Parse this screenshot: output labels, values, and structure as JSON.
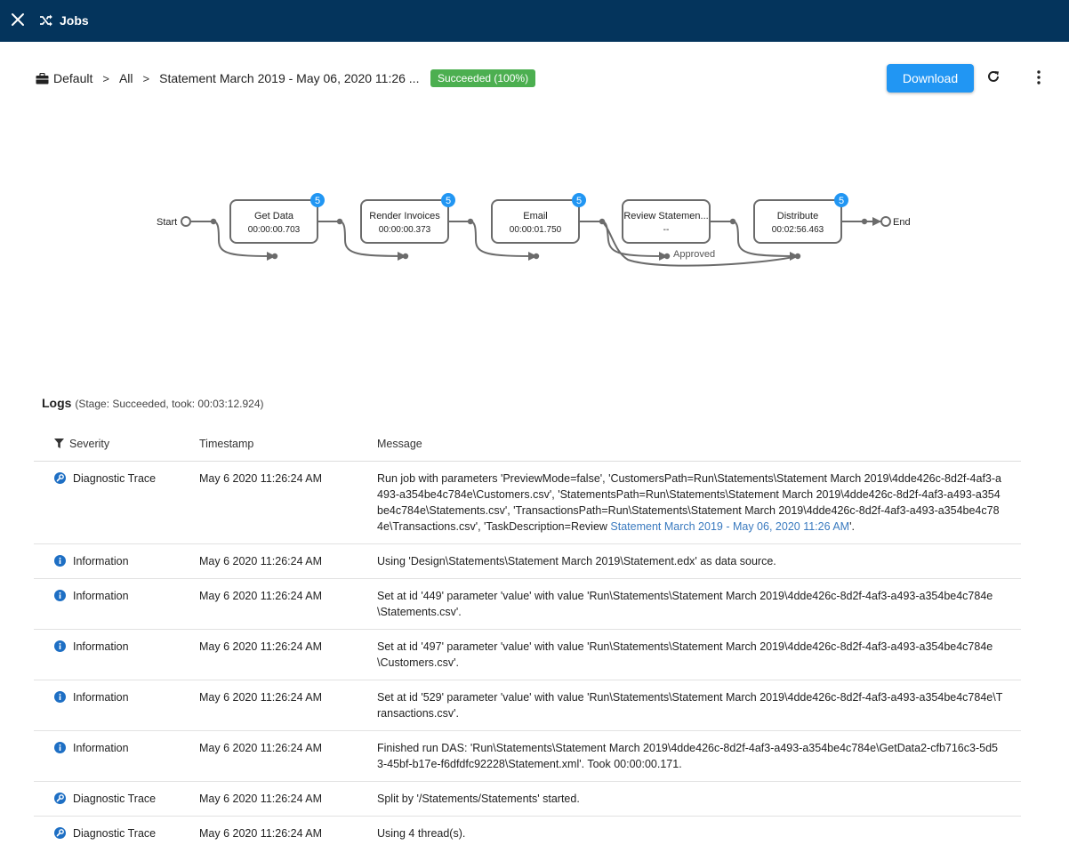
{
  "topbar": {
    "title": "Jobs",
    "close_icon": "close-icon",
    "app_icon": "shuffle-icon",
    "bg_color": "#04345c"
  },
  "breadcrumb": {
    "root": "Default",
    "root_icon": "briefcase-icon",
    "level2": "All",
    "current": "Statement March 2019 - May 06, 2020 11:26 ...",
    "separator": ">"
  },
  "status_badge": {
    "label": "Succeeded (100%)",
    "color": "#4caf50"
  },
  "toolbar": {
    "download_label": "Download",
    "refresh_icon": "refresh-icon",
    "more_icon": "more-vert-icon",
    "accent": "#2196f3"
  },
  "workflow": {
    "start_label": "Start",
    "end_label": "End",
    "stages": [
      {
        "name": "Get Data",
        "time": "00:00:00.703",
        "count": "5"
      },
      {
        "name": "Render Invoices",
        "time": "00:00:00.373",
        "count": "5"
      },
      {
        "name": "Email",
        "time": "00:00:01.750",
        "count": "5"
      },
      {
        "name": "Review Statemen...",
        "time": "--",
        "count": ""
      },
      {
        "name": "Distribute",
        "time": "00:02:56.463",
        "count": "5"
      }
    ],
    "edge_label": "Approved"
  },
  "logs": {
    "title": "Logs",
    "subtitle": "(Stage: Succeeded, took: 00:03:12.924)",
    "columns": {
      "severity": "Severity",
      "timestamp": "Timestamp",
      "message": "Message"
    },
    "rows": [
      {
        "severity": "Diagnostic Trace",
        "type": "trace",
        "timestamp": "May 6 2020 11:26:24 AM",
        "message": "Run job with parameters 'PreviewMode=false', 'CustomersPath=Run\\Statements\\Statement March 2019\\4dde426c-8d2f-4af3-a493-a354be4c784e\\Customers.csv', 'StatementsPath=Run\\Statements\\Statement March 2019\\4dde426c-8d2f-4af3-a493-a354be4c784e\\Statements.csv', 'TransactionsPath=Run\\Statements\\Statement March 2019\\4dde426c-8d2f-4af3-a493-a354be4c784e\\Transactions.csv', 'TaskDescription=Review ",
        "link": "Statement March 2019 - May 06, 2020 11:26 AM",
        "message_end": "'."
      },
      {
        "severity": "Information",
        "type": "info",
        "timestamp": "May 6 2020 11:26:24 AM",
        "message": "Using 'Design\\Statements\\Statement March 2019\\Statement.edx' as data source."
      },
      {
        "severity": "Information",
        "type": "info",
        "timestamp": "May 6 2020 11:26:24 AM",
        "message": "Set at id '449' parameter 'value' with value 'Run\\Statements\\Statement March 2019\\4dde426c-8d2f-4af3-a493-a354be4c784e\\Statements.csv'."
      },
      {
        "severity": "Information",
        "type": "info",
        "timestamp": "May 6 2020 11:26:24 AM",
        "message": "Set at id '497' parameter 'value' with value 'Run\\Statements\\Statement March 2019\\4dde426c-8d2f-4af3-a493-a354be4c784e\\Customers.csv'."
      },
      {
        "severity": "Information",
        "type": "info",
        "timestamp": "May 6 2020 11:26:24 AM",
        "message": "Set at id '529' parameter 'value' with value 'Run\\Statements\\Statement March 2019\\4dde426c-8d2f-4af3-a493-a354be4c784e\\Transactions.csv'."
      },
      {
        "severity": "Information",
        "type": "info",
        "timestamp": "May 6 2020 11:26:24 AM",
        "message": "Finished run DAS: 'Run\\Statements\\Statement March 2019\\4dde426c-8d2f-4af3-a493-a354be4c784e\\GetData2-cfb716c3-5d53-45bf-b17e-f6dfdfc92228\\Statement.xml'. Took 00:00:00.171."
      },
      {
        "severity": "Diagnostic Trace",
        "type": "trace",
        "timestamp": "May 6 2020 11:26:24 AM",
        "message": "Split by '/Statements/Statements' started."
      },
      {
        "severity": "Diagnostic Trace",
        "type": "trace",
        "timestamp": "May 6 2020 11:26:24 AM",
        "message": "Using 4 thread(s)."
      }
    ]
  }
}
